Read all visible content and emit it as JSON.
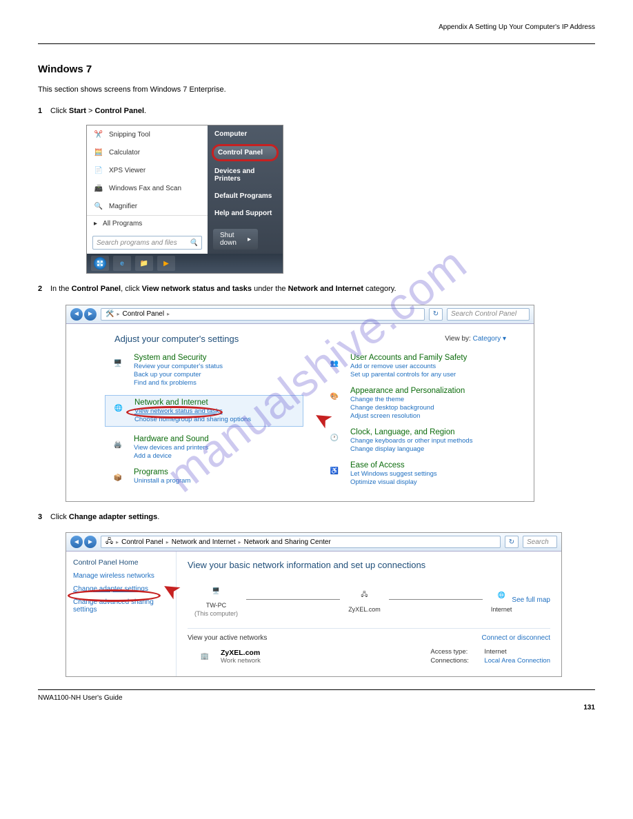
{
  "header_text": "Appendix A Setting Up Your Computer's IP Address",
  "section_title": "Windows 7",
  "intro": "This section shows screens from Windows 7 Enterprise.",
  "step1_a": "Click ",
  "step1_b": "Start",
  "step1_c": " > ",
  "step1_d": "Control Panel",
  "step1_e": ".",
  "step2_a": "In the ",
  "step2_b": "Control Panel",
  "step2_c": ", click ",
  "step2_d": "View network status and tasks",
  "step2_e": " under the ",
  "step2_f": "Network and Internet",
  "step2_g": " category.",
  "step3_a": "Click ",
  "step3_b": "Change adapter settings",
  "step3_c": ".",
  "start_menu": {
    "left_items": [
      "Snipping Tool",
      "Calculator",
      "XPS Viewer",
      "Windows Fax and Scan",
      "Magnifier"
    ],
    "all_programs": "All Programs",
    "search_placeholder": "Search programs and files",
    "right_items": [
      "Computer",
      "Control Panel",
      "Devices and Printers",
      "Default Programs",
      "Help and Support"
    ],
    "highlight_item": "Control Panel",
    "shutdown": "Shut down"
  },
  "cp1": {
    "breadcrumb": [
      "Control Panel"
    ],
    "search_placeholder": "Search Control Panel",
    "title": "Adjust your computer's settings",
    "view_by_label": "View by:",
    "view_by_value": "Category ▾",
    "left": [
      {
        "title": "System and Security",
        "links": [
          "Review your computer's status",
          "Back up your computer",
          "Find and fix problems"
        ]
      },
      {
        "title": "Network and Internet",
        "links": [
          "View network status and tasks",
          "Choose homegroup and sharing options"
        ],
        "selected": true,
        "circled_link": 0
      },
      {
        "title": "Hardware and Sound",
        "links": [
          "View devices and printers",
          "Add a device"
        ]
      },
      {
        "title": "Programs",
        "links": [
          "Uninstall a program"
        ]
      }
    ],
    "right": [
      {
        "title": "User Accounts and Family Safety",
        "links": [
          "Add or remove user accounts",
          "Set up parental controls for any user"
        ]
      },
      {
        "title": "Appearance and Personalization",
        "links": [
          "Change the theme",
          "Change desktop background",
          "Adjust screen resolution"
        ]
      },
      {
        "title": "Clock, Language, and Region",
        "links": [
          "Change keyboards or other input methods",
          "Change display language"
        ]
      },
      {
        "title": "Ease of Access",
        "links": [
          "Let Windows suggest settings",
          "Optimize visual display"
        ]
      }
    ]
  },
  "cp2": {
    "breadcrumb": [
      "Control Panel",
      "Network and Internet",
      "Network and Sharing Center"
    ],
    "search_placeholder": "Search",
    "side_home": "Control Panel Home",
    "side_links": [
      "Manage wireless networks",
      "Change adapter settings",
      "Change advanced sharing settings"
    ],
    "circled_side_link": 1,
    "main_title": "View your basic network information and set up connections",
    "see_full_map": "See full map",
    "nodes": [
      {
        "name": "TW-PC",
        "sub": "(This computer)"
      },
      {
        "name": "ZyXEL.com",
        "sub": ""
      },
      {
        "name": "Internet",
        "sub": ""
      }
    ],
    "active_header": "View your active networks",
    "connect_disconnect": "Connect or disconnect",
    "network": {
      "name": "ZyXEL.com",
      "type": "Work network"
    },
    "conn": {
      "access_label": "Access type:",
      "access_value": "Internet",
      "conn_label": "Connections:",
      "conn_value": "Local Area Connection"
    }
  },
  "footer_text": "NWA1100-NH User's Guide",
  "page_number": "131",
  "watermark": "manualshive.com"
}
